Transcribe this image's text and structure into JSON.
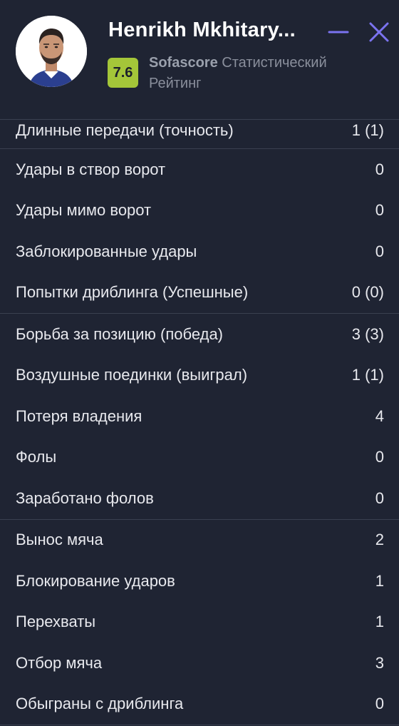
{
  "header": {
    "player_name": "Henrikh Mkhitary...",
    "rating": "7.6",
    "rating_brand": "Sofascore",
    "rating_caption_line1": "Статистический",
    "rating_caption_line2": "Рейтинг",
    "badge_color": "#a4c639",
    "icons": {
      "minimize": "minimize-icon",
      "close": "close-icon",
      "avatar": "player-avatar"
    },
    "accent_color": "#7b73f0"
  },
  "stats": {
    "group0": [
      {
        "label": "Длинные передачи (точность)",
        "value": "1 (1)"
      }
    ],
    "group1": [
      {
        "label": "Удары в створ ворот",
        "value": "0"
      },
      {
        "label": "Удары мимо ворот",
        "value": "0"
      },
      {
        "label": "Заблокированные удары",
        "value": "0"
      },
      {
        "label": "Попытки дриблинга (Успешные)",
        "value": "0 (0)"
      }
    ],
    "group2": [
      {
        "label": "Борьба за позицию (победа)",
        "value": "3 (3)"
      },
      {
        "label": "Воздушные поединки (выиграл)",
        "value": "1 (1)"
      },
      {
        "label": "Потеря владения",
        "value": "4"
      },
      {
        "label": "Фолы",
        "value": "0"
      },
      {
        "label": "Заработано фолов",
        "value": "0"
      }
    ],
    "group3": [
      {
        "label": "Вынос мяча",
        "value": "2"
      },
      {
        "label": "Блокирование ударов",
        "value": "1"
      },
      {
        "label": "Перехваты",
        "value": "1"
      },
      {
        "label": "Отбор мяча",
        "value": "3"
      },
      {
        "label": "Обыграны с дриблинга",
        "value": "0"
      }
    ]
  }
}
